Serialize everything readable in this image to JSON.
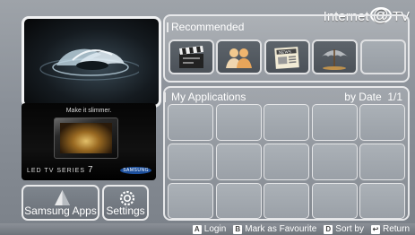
{
  "brand": {
    "text": "Internet",
    "at": "@",
    "suffix": "TV"
  },
  "left": {
    "ad": {
      "tagline": "Make it slimmer.",
      "series_text": "LED TV SERIES",
      "series_num": "7",
      "logo": "SAMSUNG"
    },
    "buttons": [
      {
        "label": "Samsung Apps",
        "icon": "samsung-apps-icon"
      },
      {
        "label": "Settings",
        "icon": "gear-icon"
      }
    ]
  },
  "recommended": {
    "title": "Recommended",
    "items": [
      {
        "icon": "clapperboard-icon"
      },
      {
        "icon": "people-icon"
      },
      {
        "icon": "news-icon"
      },
      {
        "icon": "umbrella-weather-icon"
      },
      {
        "icon": ""
      }
    ]
  },
  "my_apps": {
    "title": "My Applications",
    "sort": "by Date",
    "page": "1/1"
  },
  "footer": {
    "items": [
      {
        "key": "A",
        "label": "Login"
      },
      {
        "key": "B",
        "label": "Mark as Favourite"
      },
      {
        "key": "D",
        "label": "Sort by"
      },
      {
        "key": "↩",
        "label": "Return"
      }
    ]
  }
}
